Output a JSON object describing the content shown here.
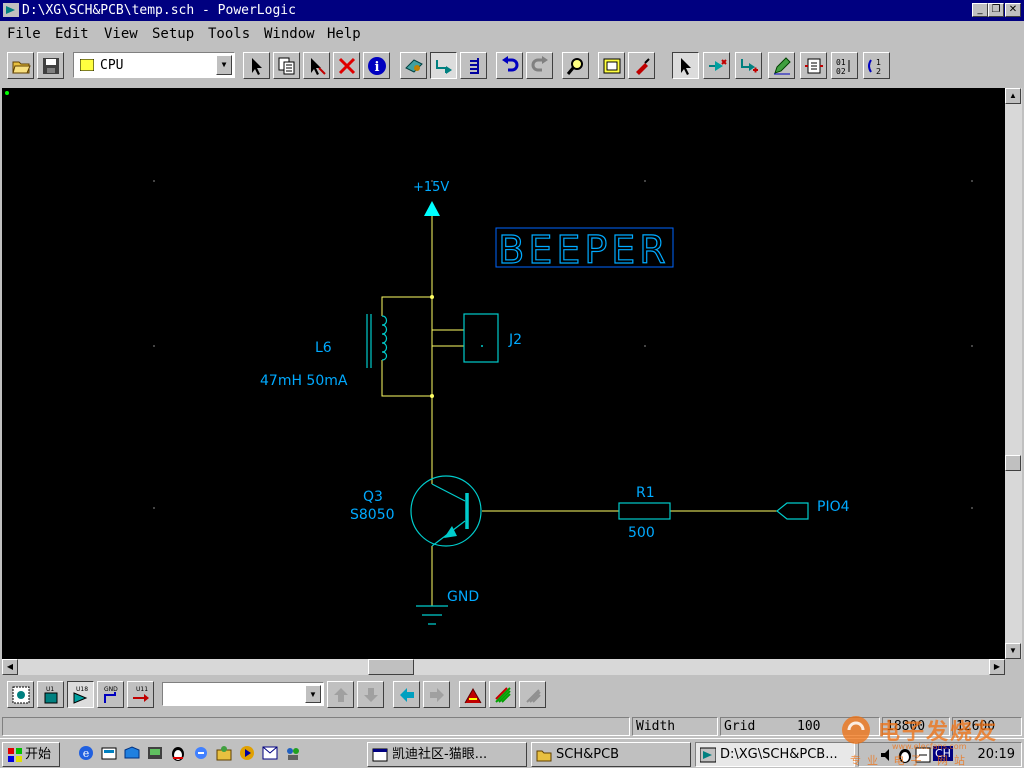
{
  "window": {
    "title": "D:\\XG\\SCH&PCB\\temp.sch - PowerLogic"
  },
  "menu": [
    "File",
    "Edit",
    "View",
    "Setup",
    "Tools",
    "Window",
    "Help"
  ],
  "toolbar": {
    "combo_value": "CPU"
  },
  "schematic": {
    "title": "BEEPER",
    "power": "+15V",
    "ground": "GND",
    "inductor": {
      "ref": "L6",
      "value": "47mH 50mA"
    },
    "connector": {
      "ref": "J2"
    },
    "transistor": {
      "ref": "Q3",
      "value": "S8050"
    },
    "resistor": {
      "ref": "R1",
      "value": "500"
    },
    "port": "PIO4"
  },
  "bottom_toolbar": {
    "icon_labels": [
      "U1",
      "U18",
      "GND",
      "U11"
    ]
  },
  "status": {
    "width_label": "Width",
    "grid_label": "Grid",
    "grid_value": "100",
    "x_coord": "18800",
    "y_coord": "12600"
  },
  "taskbar": {
    "start_label": "开始",
    "tasks": [
      "凯迪社区-猫眼...",
      "SCH&PCB",
      "D:\\XG\\SCH&PCB..."
    ],
    "tray_lang": "CH",
    "clock": "20:19"
  },
  "watermark": {
    "text": "电子发烧友",
    "url": "www.elecfans.com",
    "line2": "专业 电子 网站"
  },
  "colors": {
    "titlebar": "#000080",
    "canvas": "#000000",
    "wire": "#ffff66",
    "component": "#00ffff",
    "label": "#00aaff"
  }
}
